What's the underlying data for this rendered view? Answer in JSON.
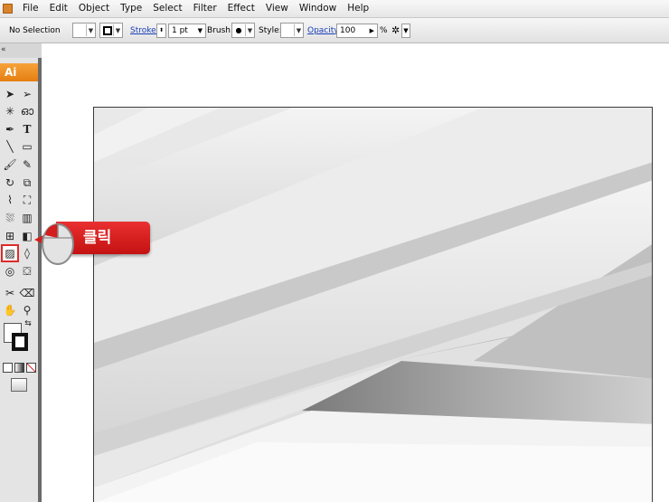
{
  "menubar": {
    "items": [
      "File",
      "Edit",
      "Object",
      "Type",
      "Select",
      "Filter",
      "Effect",
      "View",
      "Window",
      "Help"
    ]
  },
  "controlbar": {
    "selection_status": "No Selection",
    "stroke_label": "Stroke:",
    "stroke_weight": "1 pt",
    "brush_label": "Brush:",
    "style_label": "Style:",
    "opacity_label": "Opacity:",
    "opacity_value": "100",
    "opacity_unit": "%"
  },
  "tools_panel": {
    "collapse_glyph": "«",
    "app_badge": "Ai",
    "highlighted_tool": "gradient-tool-icon"
  },
  "callout": {
    "label": "클릭",
    "color": "#d41d1d"
  },
  "colors": {
    "app_accent": "#e57e12",
    "artboard_bg": "#e6e6e6"
  }
}
